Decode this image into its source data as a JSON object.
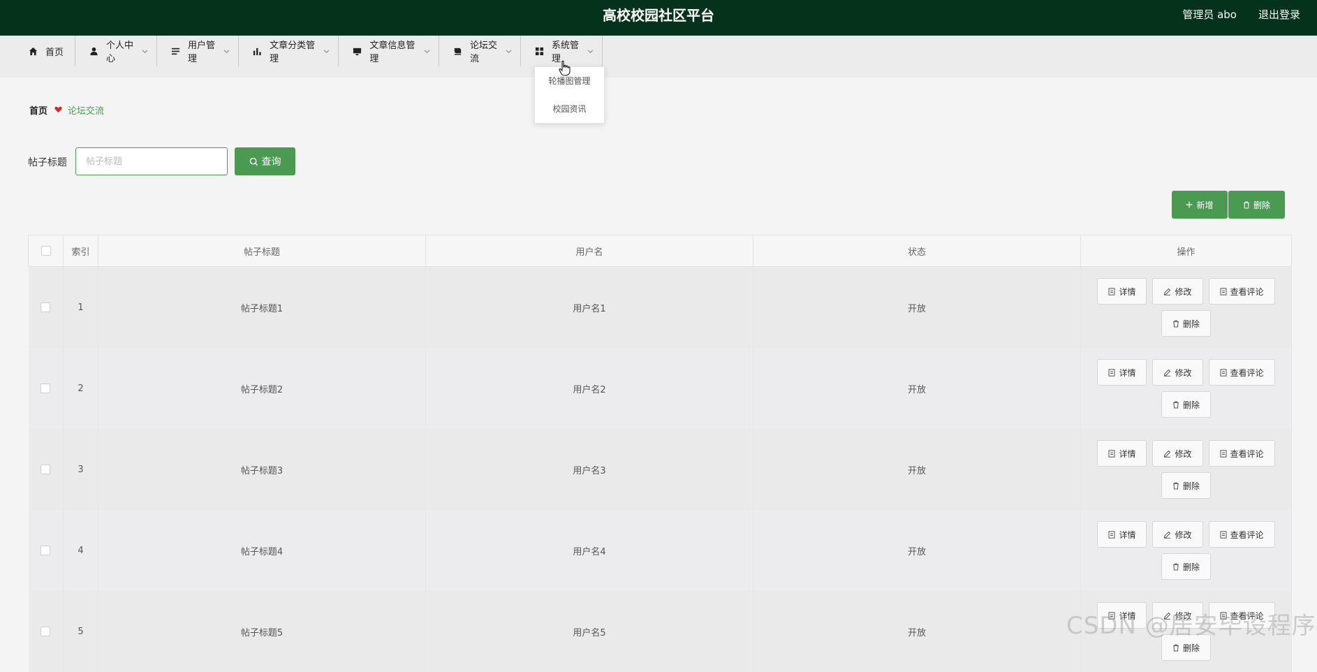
{
  "header": {
    "title": "高校校园社区平台",
    "user_label": "管理员 abo",
    "logout_label": "退出登录",
    "bg_color": "#04321a"
  },
  "nav": {
    "items": [
      {
        "label": "首页",
        "icon": "home-icon",
        "has_dropdown": false
      },
      {
        "label": "个人中心",
        "icon": "user-icon",
        "has_dropdown": true
      },
      {
        "label": "用户管理",
        "icon": "list-icon",
        "has_dropdown": true
      },
      {
        "label": "文章分类管理",
        "icon": "bar-chart-icon",
        "has_dropdown": true
      },
      {
        "label": "文章信息管理",
        "icon": "monitor-icon",
        "has_dropdown": true
      },
      {
        "label": "论坛交流",
        "icon": "book-icon",
        "has_dropdown": true
      },
      {
        "label": "系统管理",
        "icon": "grid-icon",
        "has_dropdown": true
      }
    ],
    "dropdown": {
      "parent": "系统管理",
      "items": [
        "轮播图管理",
        "校园资讯"
      ]
    }
  },
  "breadcrumb": {
    "home": "首页",
    "current": "论坛交流"
  },
  "search": {
    "label": "帖子标题",
    "placeholder": "帖子标题",
    "value": "",
    "button_label": "查询"
  },
  "actions": {
    "add_label": "新增",
    "delete_label": "删除"
  },
  "table": {
    "columns": [
      "索引",
      "帖子标题",
      "用户名",
      "状态",
      "操作"
    ],
    "rows": [
      {
        "index": "1",
        "title": "帖子标题1",
        "user": "用户名1",
        "status": "开放"
      },
      {
        "index": "2",
        "title": "帖子标题2",
        "user": "用户名2",
        "status": "开放"
      },
      {
        "index": "3",
        "title": "帖子标题3",
        "user": "用户名3",
        "status": "开放"
      },
      {
        "index": "4",
        "title": "帖子标题4",
        "user": "用户名4",
        "status": "开放"
      },
      {
        "index": "5",
        "title": "帖子标题5",
        "user": "用户名5",
        "status": "开放"
      }
    ],
    "row_actions": {
      "detail": "详情",
      "edit": "修改",
      "comments": "查看评论",
      "delete": "删除"
    }
  },
  "watermark": "CSDN @居安毕设程序",
  "colors": {
    "accent": "#4a9a52",
    "breadcrumb_heart": "#e02424"
  }
}
